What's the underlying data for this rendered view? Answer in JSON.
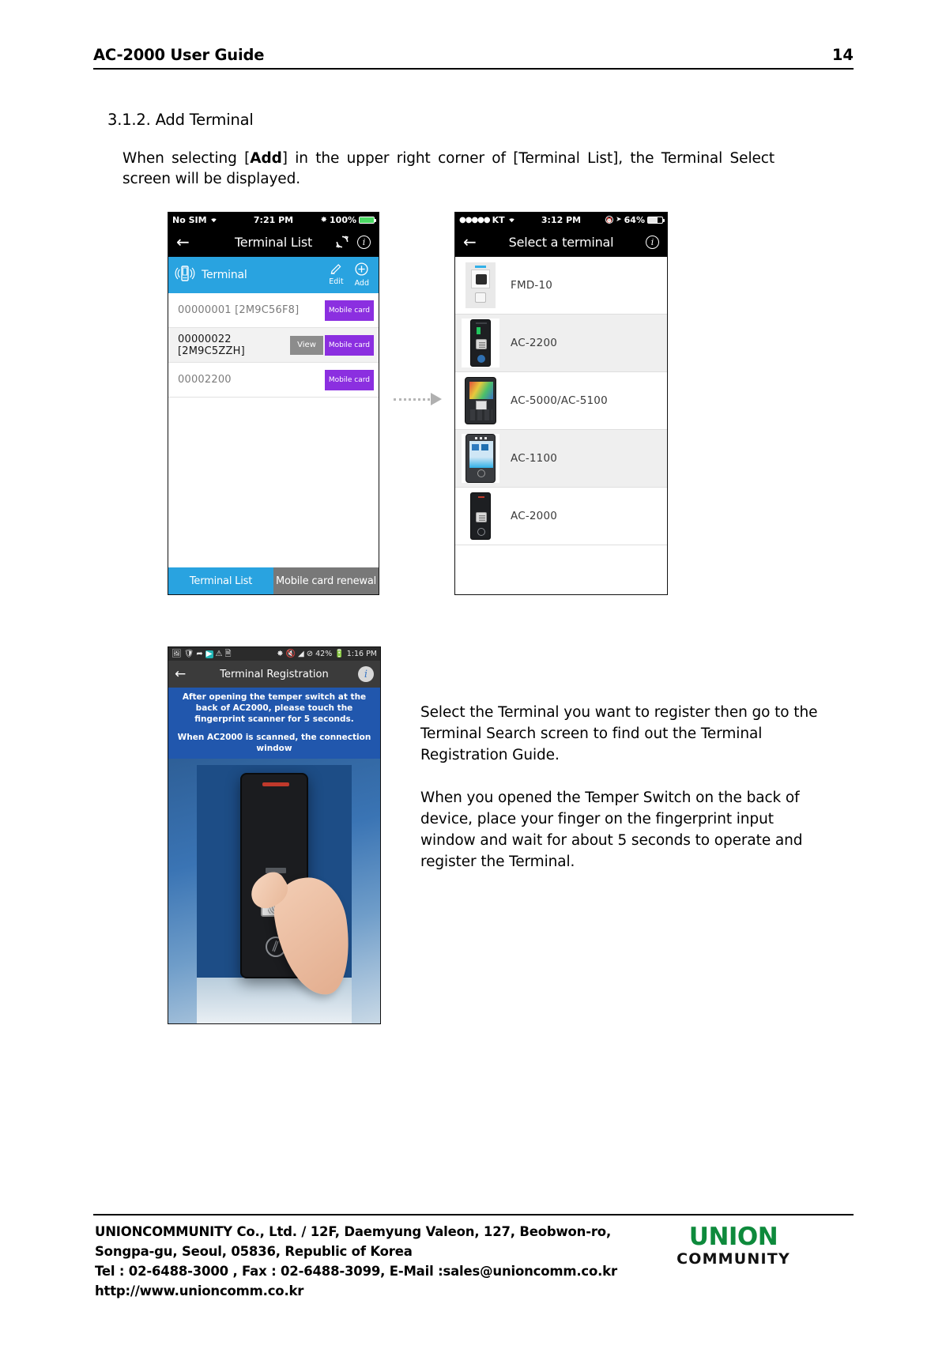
{
  "header": {
    "title": "AC-2000 User Guide",
    "page_number": "14"
  },
  "section": {
    "title": "3.1.2. Add Terminal",
    "intro_prefix": "When selecting [",
    "intro_bold": "Add",
    "intro_suffix": "] in the upper right corner of [Terminal List], the Terminal Select screen will be displayed."
  },
  "phone1": {
    "status": {
      "carrier": "No SIM",
      "wifi_icon": "wifi-icon",
      "time": "7:21 PM",
      "bluetooth_icon": "bluetooth-icon",
      "battery": "100%"
    },
    "navbar": {
      "back_icon": "back-arrow-icon",
      "title": "Terminal List",
      "refresh_icon": "refresh-icon",
      "info_icon": "info-icon"
    },
    "section_bar": {
      "device_icon": "terminal-broadcast-icon",
      "label": "Terminal",
      "edit_label": "Edit",
      "edit_icon": "pencil-icon",
      "add_label": "Add",
      "add_icon": "plus-circle-icon",
      "color": "#29a3e0"
    },
    "rows": [
      {
        "name": "00000001 [2M9C56F8]",
        "view_label": "",
        "card_label": "Mobile card",
        "selected": false
      },
      {
        "name": "00000022 [2M9C5ZZH]",
        "view_label": "View",
        "card_label": "Mobile card",
        "selected": true
      },
      {
        "name": "00002200",
        "view_label": "",
        "card_label": "Mobile card",
        "selected": false
      }
    ],
    "tabs": [
      {
        "label": "Terminal List",
        "active": true
      },
      {
        "label": "Mobile card renewal",
        "active": false
      }
    ]
  },
  "phone2": {
    "status": {
      "carrier": "KT",
      "signal_icon": "signal-dots-icon",
      "wifi_icon": "wifi-icon",
      "time": "3:12 PM",
      "alarm_icon": "alarm-icon",
      "location_icon": "location-icon",
      "battery": "64%"
    },
    "navbar": {
      "back_icon": "back-arrow-icon",
      "title": "Select a terminal",
      "info_icon": "info-icon"
    },
    "items": [
      {
        "label": "FMD-10",
        "device": "fmd10"
      },
      {
        "label": "AC-2200",
        "device": "ac2200"
      },
      {
        "label": "AC-5000/AC-5100",
        "device": "ac5000"
      },
      {
        "label": "AC-1100",
        "device": "ac1100"
      },
      {
        "label": "AC-2000",
        "device": "ac2000"
      }
    ]
  },
  "phone3": {
    "status": {
      "icons": [
        "image-icon",
        "shield-icon",
        "export-icon",
        "play-icon",
        "warning-icon",
        "document-icon",
        "bluetooth-icon",
        "mute-icon",
        "wifi-icon",
        "block-icon"
      ],
      "battery": "42%",
      "battery_icon": "battery-charging-icon",
      "time": "1:16 PM"
    },
    "actionbar": {
      "back_icon": "back-arrow-icon",
      "title": "Terminal Registration",
      "info_icon": "info-icon"
    },
    "banner1": "After opening the temper switch at the back of AC2000, please touch the fingerprint scanner for 5 seconds.",
    "banner2": "When AC2000 is scanned, the connection window"
  },
  "explanation": {
    "paragraph1": "Select the Terminal you want to register then go to the Terminal Search screen to find out the Terminal Registration Guide.",
    "paragraph2": "When you opened the Temper Switch on the  back of device, place your finger on the  fingerprint input window and wait for about 5    seconds to operate and register the Terminal."
  },
  "footer": {
    "line1": "UNIONCOMMUNITY Co., Ltd. / 12F, Daemyung Valeon, 127, Beobwon-ro,",
    "line2": "Songpa-gu, Seoul, 05836, Republic of Korea",
    "line3": "Tel : 02-6488-3000 , Fax : 02-6488-3099, E-Mail :sales@unioncomm.co.kr",
    "line4": "http://www.unioncomm.co.kr",
    "logo_mark": "UNION",
    "logo_word": "COMMUNITY",
    "logo_color": "#0e8a3c"
  }
}
